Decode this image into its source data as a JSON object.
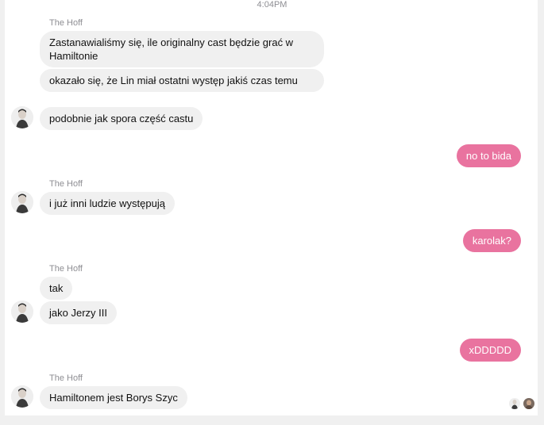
{
  "timestamp": "4:04PM",
  "sender_name": "The Hoff",
  "messages": {
    "m1": "Zastanawialiśmy się, ile originalny cast będzie grać w Hamiltonie",
    "m2": "okazało się, że Lin miał ostatni występ jakiś czas temu",
    "m3": "podobnie jak spora część castu",
    "m4": "no to bida",
    "m5": "i już inni ludzie występują",
    "m6": "karolak?",
    "m7": "tak",
    "m8": "jako Jerzy III",
    "m9": "xDDDDD",
    "m10": "Hamiltonem jest Borys Szyc"
  },
  "colors": {
    "outgoing_bubble": "#e9739f",
    "incoming_bubble": "#f0f0f0",
    "meta_text": "#8e8e93"
  },
  "icons": {
    "avatar": "person-photo-icon",
    "seen_receipts": [
      "person-photo-icon",
      "person-photo-icon"
    ]
  }
}
